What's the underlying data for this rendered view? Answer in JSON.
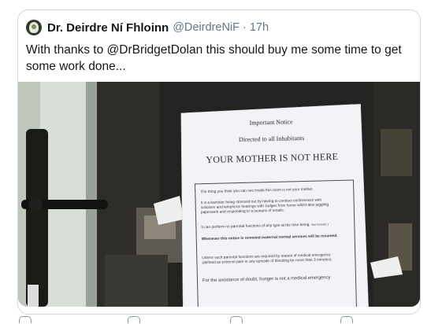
{
  "tweet": {
    "author_name": "Dr. Deirdre Ní Fhloinn",
    "handle": "@DeirdreNiF",
    "separator": "·",
    "time": "17h",
    "text_line1": "With thanks to @DrBridgetDolan this should buy me some time to get",
    "text_line2": "some work done..."
  },
  "notice": {
    "title": "Important Notice",
    "subtitle": "Directed to all Inhabitants",
    "headline": "YOUR MOTHER IS NOT HERE",
    "p1": "The thing you think you can see inside this room is not your mother.",
    "p2_l1": "It is a barrister being stressed out by having to conduct conferences with",
    "p2_l2": "solicitors and telephone hearings with Judges from home whilst also juggling",
    "p2_l3": "paperwork and responding to a tsunami of emails.",
    "p3": "It can perform no parental functions of any type at the time being.",
    "p3_note": "See footnote 1",
    "p4": "Whenever this notice is removed maternal normal services will be resumed.",
    "p5_l1": "Unless such parental functions are required by reason of medical emergency",
    "p5_l2": "(defined as extreme pain or any episode of bleeding for more than 3 minutes).",
    "p6": "For the avoidance of doubt, hunger is not a medical emergency"
  },
  "colors": {
    "text": "#14171a",
    "secondary": "#657786",
    "border": "#cfd9de"
  }
}
